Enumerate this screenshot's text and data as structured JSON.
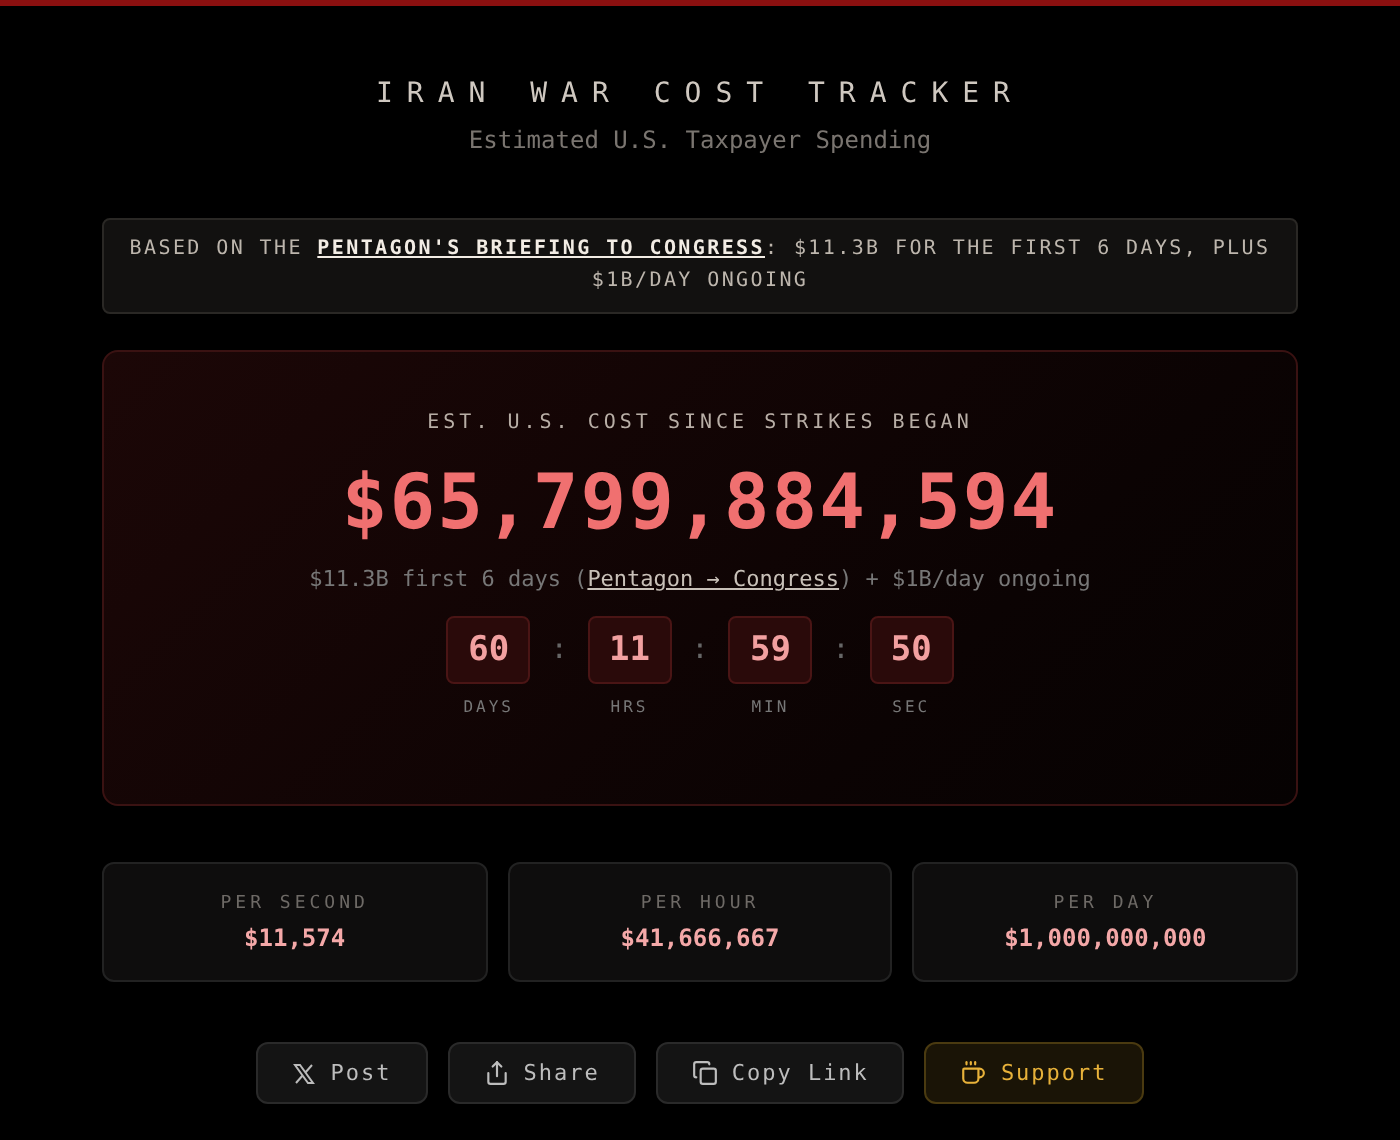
{
  "header": {
    "title": "IRAN WAR COST TRACKER",
    "subtitle": "Estimated U.S. Taxpayer Spending"
  },
  "banner": {
    "prefix": "BASED ON THE ",
    "link": "PENTAGON'S BRIEFING TO CONGRESS",
    "suffix": ": $11.3B FOR THE FIRST 6 DAYS, PLUS $1B/DAY ONGOING"
  },
  "counter": {
    "label": "EST. U.S. COST SINCE STRIKES BEGAN",
    "amount": "$65,799,884,594",
    "note_prefix": "$11.3B first 6 days (",
    "note_link": "Pentagon → Congress",
    "note_suffix": ") + $1B/day ongoing",
    "units": [
      {
        "value": "60",
        "label": "DAYS"
      },
      {
        "value": "11",
        "label": "HRS"
      },
      {
        "value": "59",
        "label": "MIN"
      },
      {
        "value": "50",
        "label": "SEC"
      }
    ],
    "separator": ":"
  },
  "rates": [
    {
      "label": "PER SECOND",
      "value": "$11,574"
    },
    {
      "label": "PER HOUR",
      "value": "$41,666,667"
    },
    {
      "label": "PER DAY",
      "value": "$1,000,000,000"
    }
  ],
  "buttons": [
    {
      "kind": "post",
      "label": "Post"
    },
    {
      "kind": "share",
      "label": "Share"
    },
    {
      "kind": "copy",
      "label": "Copy Link"
    },
    {
      "kind": "support",
      "label": "Support"
    }
  ]
}
